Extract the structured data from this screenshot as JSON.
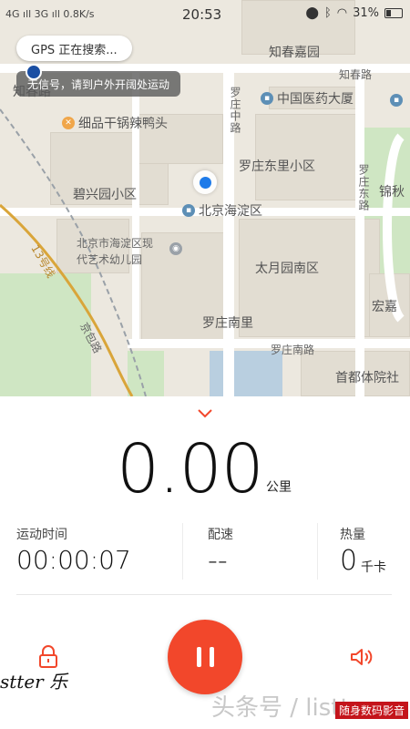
{
  "status_bar": {
    "left_text": "4G ıll 3G ıll 0.8K/s",
    "time": "20:53",
    "battery": "31%"
  },
  "map": {
    "gps_status": "GPS 正在搜索...",
    "no_signal_hint": "无信号，请到户外开阔处运动",
    "labels": {
      "zhichun_garden": "知春嘉园",
      "zhichun_road_right": "知春路",
      "zhichun_road_left": "知春路",
      "luozhuang_middle_road": "罗庄中路",
      "luozhuang_east_road": "罗庄东路",
      "jinqiu": "锦秋",
      "bixingyuan": "碧兴园小区",
      "luozhuang_east_district": "罗庄东里小区",
      "kindergarten_line1": "北京市海淀区现",
      "kindergarten_line2": "代艺术幼儿园",
      "taiyueyuan": "太月园南区",
      "luozhuang_south_li": "罗庄南里",
      "luozhuang_south_road": "罗庄南路",
      "hongjia": "宏嘉",
      "capital_sports": "首都体院社",
      "line13": "13号线",
      "jingbao_road": "京包路"
    },
    "pois": {
      "hotpot": "细品干锅辣鸭头",
      "medicine": "中国医药大厦",
      "haidian": "北京海淀区"
    }
  },
  "workout": {
    "distance": "0.00",
    "distance_unit": "公里",
    "time_label": "运动时间",
    "time_value": "00:00:07",
    "pace_label": "配速",
    "pace_value": "--",
    "calories_label": "热量",
    "calories_value": "0",
    "calories_unit": "千卡"
  },
  "watermarks": {
    "left": "stter 乐",
    "center": "头条号 / listter",
    "badge": "随身数码影音"
  },
  "colors": {
    "accent": "#f2472b",
    "location": "#1e7be9"
  }
}
